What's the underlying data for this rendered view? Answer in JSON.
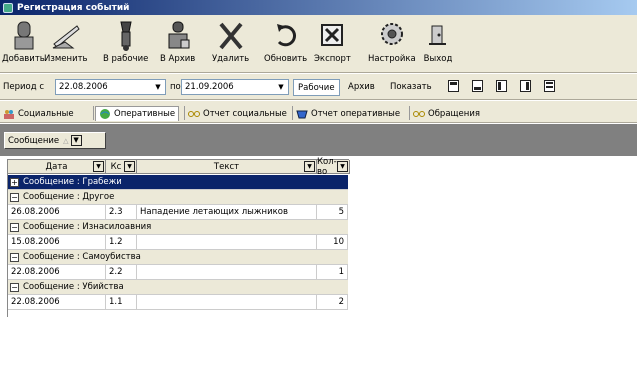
{
  "window": {
    "title": "Регистрация событий"
  },
  "toolbar": {
    "buttons": [
      {
        "label": "Добавить",
        "icon": "add-icon"
      },
      {
        "label": "Изменить",
        "icon": "edit-icon"
      },
      {
        "label": "В рабочие",
        "icon": "to-work-icon"
      },
      {
        "label": "В Архив",
        "icon": "archive-icon"
      },
      {
        "label": "Удалить",
        "icon": "delete-icon"
      },
      {
        "label": "Обновить",
        "icon": "refresh-icon"
      },
      {
        "label": "Экспорт",
        "icon": "export-icon"
      },
      {
        "label": "Настройка",
        "icon": "settings-icon"
      },
      {
        "label": "Выход",
        "icon": "exit-icon"
      }
    ]
  },
  "period": {
    "from_label": "Период с",
    "from_value": "22.08.2006",
    "to_label": "по",
    "to_value": "21.09.2006",
    "mode_working": "Рабочие",
    "mode_archive": "Архив",
    "show_label": "Показать"
  },
  "tabs": [
    {
      "label": "Социальные",
      "icon": "people-icon"
    },
    {
      "label": "Оперативные",
      "icon": "globe-icon"
    },
    {
      "label": "Отчет социальные",
      "icon": "glasses-icon"
    },
    {
      "label": "Отчет оперативные",
      "icon": "shield-icon"
    },
    {
      "label": "Обращения",
      "icon": "glasses-icon"
    }
  ],
  "grouping": {
    "field": "Сообщение",
    "sort_arrow": "△"
  },
  "grid": {
    "columns": [
      {
        "label": "Дата"
      },
      {
        "label": "Кс"
      },
      {
        "label": "Текст"
      },
      {
        "label": "Кол-во"
      }
    ],
    "groups": [
      {
        "label": "Сообщение : Грабежи",
        "expanded": false,
        "rows": []
      },
      {
        "label": "Сообщение : Другое",
        "expanded": true,
        "rows": [
          {
            "date": "26.08.2006",
            "ks": "2.3",
            "text": "Нападение летающих лыжников",
            "count": "5"
          }
        ]
      },
      {
        "label": "Сообщение : Изнасилоавния",
        "expanded": true,
        "rows": [
          {
            "date": "15.08.2006",
            "ks": "1.2",
            "text": "",
            "count": "10"
          }
        ]
      },
      {
        "label": "Сообщение : Самоубиства",
        "expanded": true,
        "rows": [
          {
            "date": "22.08.2006",
            "ks": "2.2",
            "text": "",
            "count": "1"
          }
        ]
      },
      {
        "label": "Сообщение : Убийства",
        "expanded": true,
        "rows": [
          {
            "date": "22.08.2006",
            "ks": "1.1",
            "text": "",
            "count": "2"
          }
        ]
      }
    ]
  },
  "glyphs": {
    "plus": "+",
    "minus": "−",
    "dropdown": "▼"
  }
}
